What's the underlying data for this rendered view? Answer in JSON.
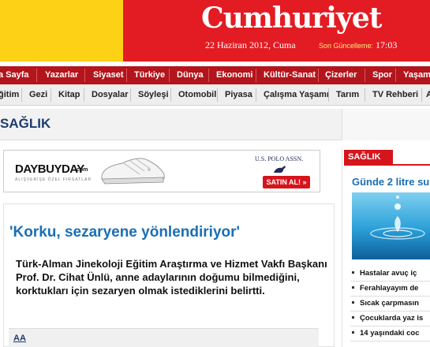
{
  "header": {
    "logo": "Cumhuriyet",
    "date": "22 Haziran 2012, Cuma",
    "update_label": "Son Güncelleme:",
    "update_time": "17:03",
    "colors": {
      "red": "#e31b23",
      "yellow": "#fcd116"
    }
  },
  "nav_primary": [
    "a Sayfa",
    "Yazarlar",
    "Siyaset",
    "Türkiye",
    "Dünya",
    "Ekonomi",
    "Kültür-Sanat",
    "Çizerler",
    "Spor",
    "Yaşam"
  ],
  "nav_secondary": [
    "ğitim",
    "Gezi",
    "Kitap",
    "Dosyalar",
    "Söyleşi",
    "Otomobil",
    "Piyasa",
    "Çalışma Yaşamı",
    "Tarım",
    "TV Rehberi",
    "A"
  ],
  "section": {
    "title": "SAĞLIK"
  },
  "ad": {
    "logo": "DAYBUYDAY",
    "logo_suffix": ".com",
    "tagline": "ALIŞVERİŞE ÖZEL FIRSATLAR",
    "brand": "U.S. POLO ASSN.",
    "button": "SATIN AL! »"
  },
  "article": {
    "headline": "'Korku, sezaryene yönlendiriyor'",
    "lead": "Türk-Alman Jinekoloji Eğitim Araştırma ve Hizmet Vakfı Başkanı Prof. Dr. Cihat Ünlü, anne adaylarının doğumu bilmediğini, korktukları için sezaryen olmak istediklerini belirtti.",
    "text_size_link": "AA"
  },
  "sidebar": {
    "tab": "SAĞLIK",
    "headline": "Günde 2 litre su",
    "items": [
      "Hastalar avuç iç",
      "Ferahlayayım de",
      "Sıcak çarpmasın",
      "Çocuklarda yaz is",
      "14 yaşındaki coc"
    ]
  }
}
